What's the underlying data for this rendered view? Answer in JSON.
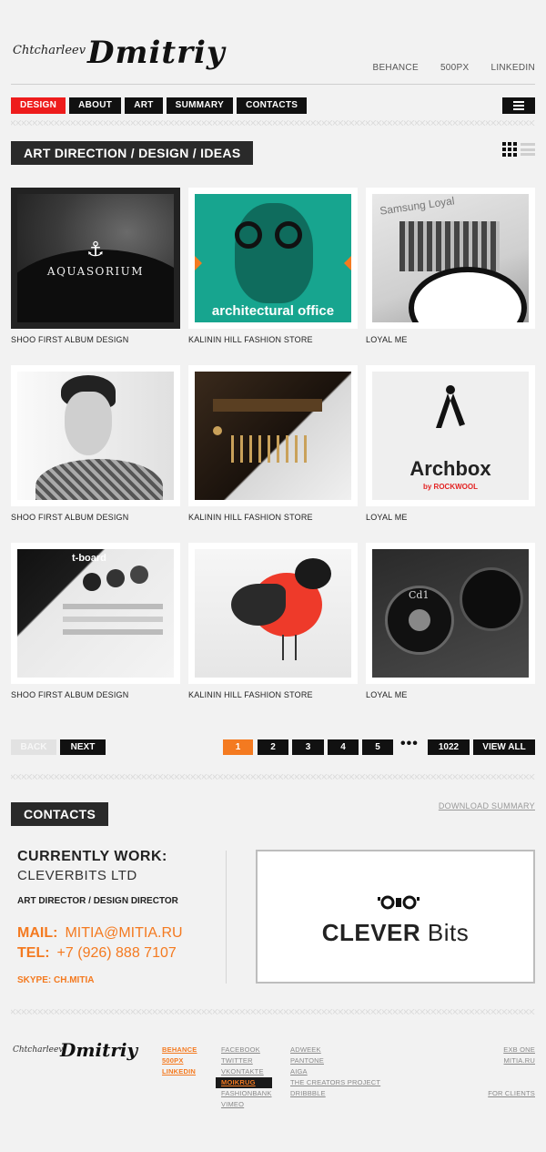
{
  "header": {
    "logo_small": "Chtcharleev",
    "logo_big": "Dmitriy",
    "social": [
      "BEHANCE",
      "500PX",
      "LINKEDIN"
    ]
  },
  "nav": {
    "items": [
      "DESIGN",
      "ABOUT",
      "ART",
      "SUMMARY",
      "CONTACTS"
    ],
    "active": "DESIGN"
  },
  "portfolio": {
    "title": "ART DIRECTION / DESIGN / IDEAS",
    "tiles": [
      {
        "caption": "SHOO FIRST ALBUM DESIGN",
        "art_text": "AQUASORIUM"
      },
      {
        "caption": "KALININ HILL FASHION STORE",
        "art_text": "architectural office"
      },
      {
        "caption": "LOYAL ME",
        "art_text": "Samsung Loyal"
      },
      {
        "caption": "SHOO FIRST ALBUM DESIGN",
        "art_text": ""
      },
      {
        "caption": "KALININ HILL FASHION STORE",
        "art_text": ""
      },
      {
        "caption": "LOYAL ME",
        "art_text": "Archbox",
        "art_sub": "by ROCKWOOL"
      },
      {
        "caption": "SHOO FIRST ALBUM DESIGN",
        "art_text": "t-board"
      },
      {
        "caption": "KALININ HILL FASHION STORE",
        "art_text": ""
      },
      {
        "caption": "LOYAL ME",
        "art_text": "Cd1"
      }
    ]
  },
  "pagination": {
    "back": "BACK",
    "next": "NEXT",
    "pages": [
      "1",
      "2",
      "3",
      "4",
      "5"
    ],
    "current": "1",
    "ellipsis": "•••",
    "last": "1022",
    "view_all": "VIEW ALL"
  },
  "contacts": {
    "title": "CONTACTS",
    "download": "DOWNLOAD SUMMARY",
    "currently_work_label": "CURRENTLY WORK:",
    "company": "CLEVERBITS LTD",
    "role": "ART DIRECTOR  / DESIGN DIRECTOR",
    "mail_label": "MAIL:",
    "mail": "MITIA@MITIA.RU",
    "tel_label": "TEL:",
    "tel": "+7 (926) 888 7107",
    "skype": "SKYPE: CH.MITIA",
    "logo_word1": "CLEVER",
    "logo_word2": "Bits"
  },
  "footer": {
    "logo_small": "Chtcharleev",
    "logo_big": "Dmitriy",
    "col1": [
      "BEHANCE",
      "500PX",
      "LINKEDIN"
    ],
    "col2": [
      "FACEBOOK",
      "TWITTER",
      "VKONTAKTE",
      "MOIKRUG",
      "FASHIONBANK",
      "VIMEO"
    ],
    "col3": [
      "ADWEEK",
      "PANTONE",
      "AIGA",
      "THE CREATORS PROJECT",
      "DRIBBBLE"
    ],
    "col4": [
      "EXB ONE",
      "MITIA.RU",
      "FOR CLIENTS"
    ]
  },
  "colors": {
    "accent_red": "#ee1c1c",
    "accent_orange": "#f47a20",
    "dark": "#111111"
  }
}
